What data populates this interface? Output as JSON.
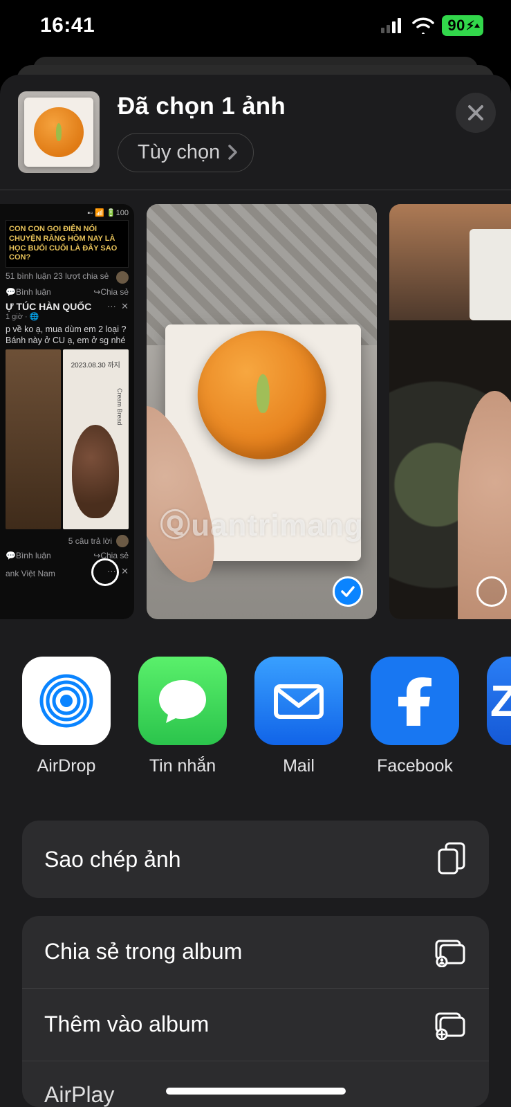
{
  "status": {
    "time": "16:41",
    "battery_text": "90"
  },
  "header": {
    "title": "Đã chọn 1 ảnh",
    "options_label": "Tùy chọn"
  },
  "strip": {
    "p0": {
      "banner": "CON CON GỌI ĐIỆN NÓI CHUYỆN RẰNG HÔM NAY LÀ HỌC BUỔI CUỐI LÀ ĐÂY SAO CON?",
      "stats": "51 bình luận   23 lượt chia sẻ",
      "comment_label": "Bình luận",
      "share_label": "Chia sẻ",
      "group": "Ự TÚC HÀN QUỐC",
      "time": "1 giờ · 🌐",
      "post_text": "p về ko ạ, mua dùm em 2 loại ? Bánh này ở CU ạ, em ở sg nhé",
      "date_label": "2023.08.30 까지",
      "bread_label": "Cream Bread",
      "replies": "5 câu trả lời",
      "bottom_bank": "ank Việt Nam"
    },
    "watermark": "Ⓠuantrimang"
  },
  "apps": [
    {
      "label": "AirDrop"
    },
    {
      "label": "Tin nhắn"
    },
    {
      "label": "Mail"
    },
    {
      "label": "Facebook"
    },
    {
      "label": "Z"
    }
  ],
  "actions": {
    "copy": "Sao chép ảnh",
    "share_in_album": "Chia sẻ trong album",
    "add_to_album": "Thêm vào album",
    "airplay": "AirPlay"
  }
}
